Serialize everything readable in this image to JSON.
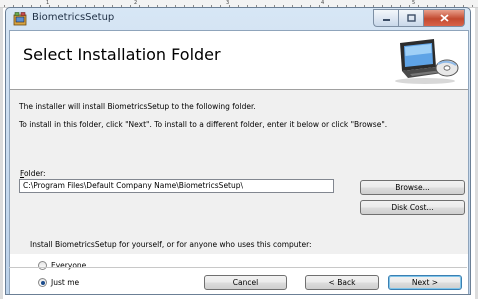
{
  "window": {
    "title": "BiometricsSetup"
  },
  "caption_buttons": {
    "minimize_icon": "minimize-icon",
    "maximize_icon": "maximize-icon",
    "close_icon": "close-icon"
  },
  "ruler": {
    "numbers": [
      "1",
      "2",
      "3",
      "4",
      "5"
    ]
  },
  "banner": {
    "title": "Select Installation Folder",
    "image_icon": "computer-disk-icon"
  },
  "body": {
    "line1": "The installer will install BiometricsSetup to the following folder.",
    "line2": "To install in this folder, click \"Next\". To install to a different folder, enter it below or click \"Browse\".",
    "folder_label_accel": "F",
    "folder_label_rest": "older:",
    "folder_value": "C:\\Program Files\\Default Company Name\\BiometricsSetup\\",
    "browse_label": "Browse...",
    "disk_cost_label": "Disk Cost...",
    "scope_prompt": "Install BiometricsSetup for yourself, or for anyone who uses this computer:",
    "radio_everyone": "Everyone",
    "radio_just_me": "Just me",
    "selected_scope": "Just me"
  },
  "footer": {
    "cancel_label": "Cancel",
    "back_label": "< Back",
    "next_label": "Next >"
  },
  "colors": {
    "close_button": "#c34a30",
    "title_bar": "#bcd2ea",
    "dialog_body": "#f0f0f0"
  }
}
